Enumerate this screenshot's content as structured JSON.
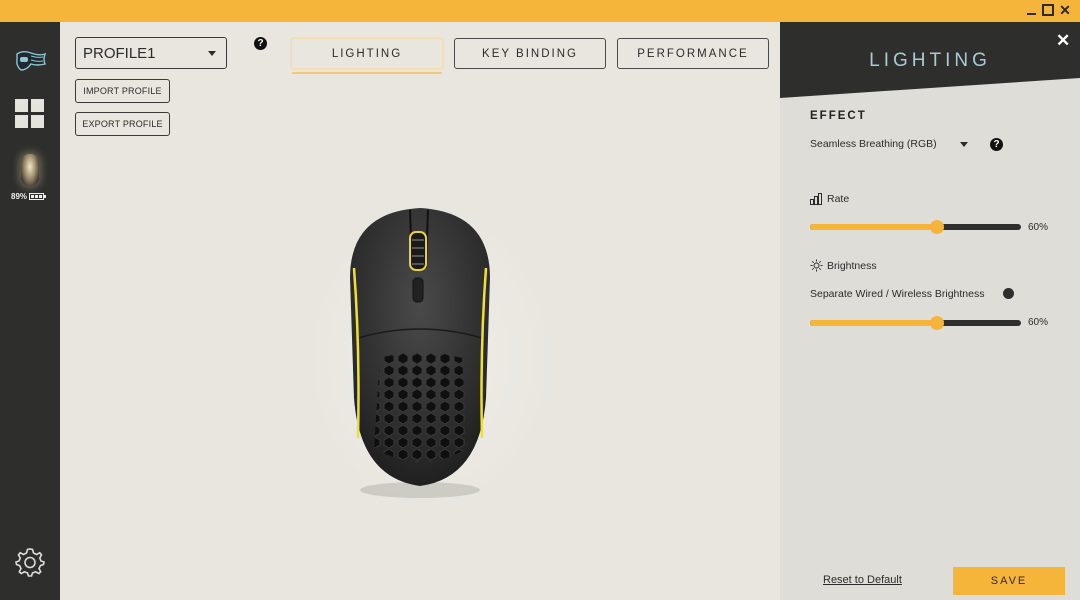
{
  "window": {
    "controls": {
      "minimize_icon": "minimize-icon",
      "maximize_icon": "maximize-icon",
      "close_label": "✕"
    },
    "accent_color": "#f5b53a",
    "sidebar_color": "#2e2e2d"
  },
  "sidebar": {
    "logo_icon": "brand-logo-icon",
    "dashboard_icon": "grid-icon",
    "device": {
      "icon": "mouse-device-icon",
      "battery_percent": "89%",
      "battery_icon": "battery-icon"
    },
    "settings_icon": "gear-icon"
  },
  "main": {
    "profile": {
      "selected": "PROFILE1"
    },
    "profile_help": "?",
    "import_label": "IMPORT PROFILE",
    "export_label": "EXPORT PROFILE",
    "tabs": [
      {
        "label": "LIGHTING",
        "active": true
      },
      {
        "label": "KEY BINDING",
        "active": false
      },
      {
        "label": "PERFORMANCE",
        "active": false
      }
    ],
    "mouse_image": "gaming-mouse-image"
  },
  "panel": {
    "title": "LIGHTING",
    "close_label": "✕",
    "effect": {
      "label": "EFFECT",
      "selected": "Seamless Breathing (RGB)",
      "help": "?"
    },
    "rate": {
      "label": "Rate",
      "icon": "bar-signal-icon",
      "value_percent": 60,
      "value_text": "60%"
    },
    "brightness": {
      "label": "Brightness",
      "icon": "sun-icon",
      "separate_label": "Separate Wired / Wireless Brightness",
      "separate_enabled": false,
      "value_percent": 60,
      "value_text": "60%"
    },
    "reset_label": "Reset to Default",
    "save_label": "SAVE"
  }
}
